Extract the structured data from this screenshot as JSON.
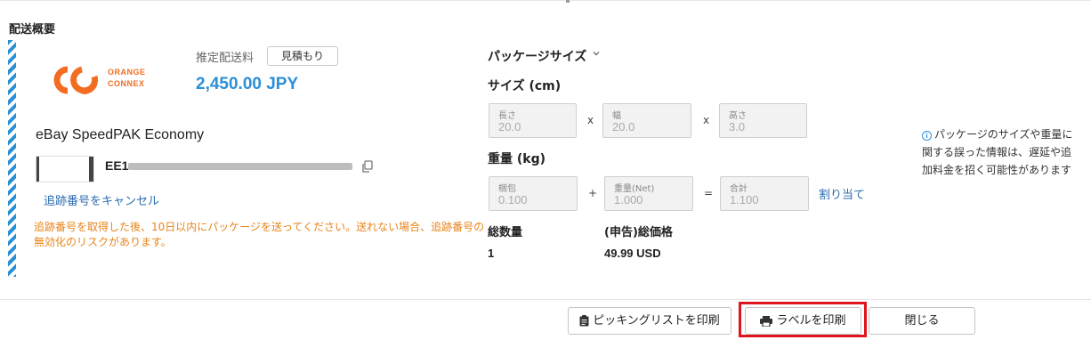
{
  "section_title": "配送概要",
  "carrier": {
    "logo_line1": "ORANGE",
    "logo_line2": "CONNEX",
    "brand_color": "#f26d21"
  },
  "fee": {
    "label": "推定配送料",
    "quote_button": "見積もり",
    "value": "2,450.00 JPY",
    "color": "#2b8fd6"
  },
  "service_name": "eBay SpeedPAK Economy",
  "tracking": {
    "prefix": "EE1",
    "copy_icon": "copy-icon",
    "cancel_link": "追跡番号をキャンセル"
  },
  "warning": "追跡番号を取得した後、10日以内にパッケージを送ってください。送れない場合、追跡番号の無効化のリスクがあります。",
  "package": {
    "title": "パッケージサイズ",
    "size_label": "サイズ (cm)",
    "length": {
      "label": "長さ",
      "value": "20.0"
    },
    "width": {
      "label": "幅",
      "value": "20.0"
    },
    "height": {
      "label": "高さ",
      "value": "3.0"
    },
    "times": "x",
    "weight_label": "重量 (kg)",
    "packing": {
      "label": "梱包",
      "value": "0.100"
    },
    "net": {
      "label": "重量(Net)",
      "value": "1.000"
    },
    "total": {
      "label": "合計",
      "value": "1.100"
    },
    "plus": "+",
    "equals": "=",
    "assign_link": "割り当て"
  },
  "totals": {
    "quantity_label": "総数量",
    "quantity_value": "1",
    "price_label": "(申告)総価格",
    "price_value": "49.99 USD"
  },
  "info_note": "パッケージのサイズや重量に関する誤った情報は、遅延や追加料金を招く可能性があります",
  "buttons": {
    "picking_list": "ピッキングリストを印刷",
    "print_label": "ラベルを印刷",
    "close": "閉じる"
  },
  "highlight_color": "#e0141e"
}
